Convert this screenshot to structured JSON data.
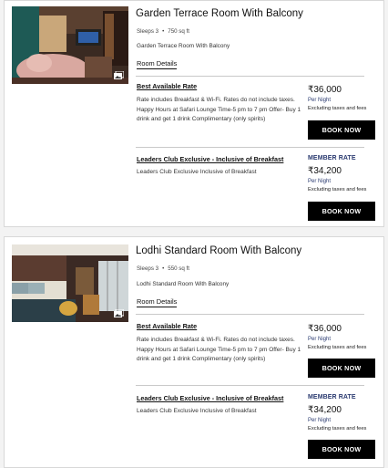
{
  "rooms": [
    {
      "title": "Garden Terrace Room With Balcony",
      "sleeps": "Sleeps 3",
      "size": "750 sq ft",
      "description": "Garden Terrace Room With Balcony",
      "details_link": "Room Details",
      "image_icon": "gallery-icon",
      "rates": [
        {
          "name": "Best Available Rate",
          "description": "Rate includes Breakfast & Wi-Fi. Rates do not include taxes. Happy Hours at Safari Lounge Time-5 pm to 7 pm Offer- Buy 1 drink and get 1 drink Complimentary (only spirits)",
          "badge": "",
          "price": "₹36,000",
          "per_night": "Per Night",
          "excl": "Excluding taxes and fees",
          "button": "BOOK NOW"
        },
        {
          "name": "Leaders Club Exclusive - Inclusive of Breakfast",
          "description": "Leaders Club Exclusive Inclusive of Breakfast",
          "badge": "MEMBER RATE",
          "price": "₹34,200",
          "per_night": "Per Night",
          "excl": "Excluding taxes and fees",
          "button": "BOOK NOW"
        }
      ]
    },
    {
      "title": "Lodhi Standard Room With Balcony",
      "sleeps": "Sleeps 3",
      "size": "550 sq ft",
      "description": "Lodhi Standard Room With Balcony",
      "details_link": "Room Details",
      "image_icon": "gallery-icon",
      "rates": [
        {
          "name": "Best Available Rate",
          "description": "Rate includes Breakfast & Wi-Fi. Rates do not include taxes. Happy Hours at Safari Lounge Time-5 pm to 7 pm Offer- Buy 1 drink and get 1 drink Complimentary (only spirits)",
          "badge": "",
          "price": "₹36,000",
          "per_night": "Per Night",
          "excl": "Excluding taxes and fees",
          "button": "BOOK NOW"
        },
        {
          "name": "Leaders Club Exclusive - Inclusive of Breakfast",
          "description": "Leaders Club Exclusive Inclusive of Breakfast",
          "badge": "MEMBER RATE",
          "price": "₹34,200",
          "per_night": "Per Night",
          "excl": "Excluding taxes and fees",
          "button": "BOOK NOW"
        }
      ]
    }
  ],
  "colors": {
    "accent_navy": "#2a3a70",
    "button_bg": "#000000",
    "border": "#d8d8d8"
  }
}
